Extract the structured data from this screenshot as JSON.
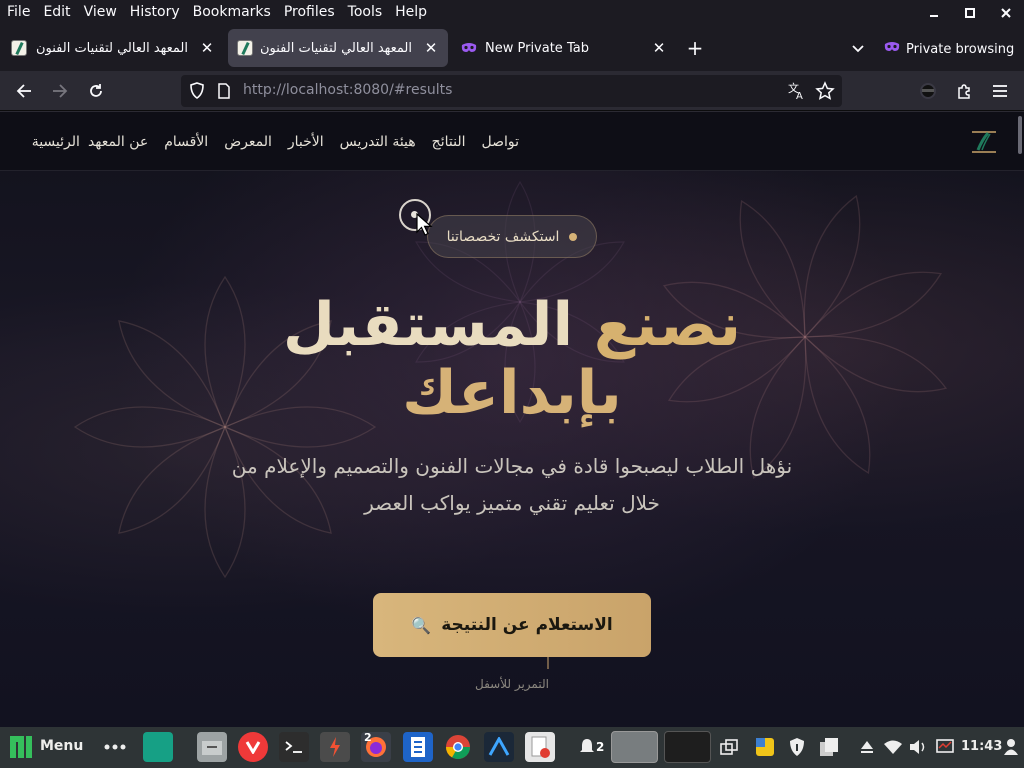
{
  "menubar": {
    "items": [
      "File",
      "Edit",
      "View",
      "History",
      "Bookmarks",
      "Profiles",
      "Tools",
      "Help"
    ],
    "window_controls": [
      "minimize-icon",
      "maximize-icon",
      "close-icon"
    ]
  },
  "tabs": [
    {
      "title": "المعهد العالي لتقنيات الفنون -",
      "close": "✕",
      "selected": false
    },
    {
      "title": "المعهد العالي لتقنيات الفنون",
      "close": "✕",
      "selected": true
    },
    {
      "title": "New Private Tab",
      "close": "✕",
      "selected": false
    }
  ],
  "tabstrip": {
    "new_tab": "+",
    "private_label": "Private browsing"
  },
  "navbar": {
    "url_host": "http://localhost",
    "url_rest": ":8080/#results"
  },
  "site": {
    "nav": [
      "الرئيسية",
      "عن المعهد",
      "الأقسام",
      "المعرض",
      "الأخبار",
      "هيئة التدريس",
      "النتائج",
      "تواصل"
    ],
    "badge": "استكشف تخصصاتنا",
    "title_line1_plain": "المستقبل",
    "title_line1_accent": "نصنع",
    "title_line2": "بإبداعك",
    "subtitle_line1": "نؤهل الطلاب ليصبحوا قادة في مجالات الفنون والتصميم والإعلام من",
    "subtitle_line2": "خلال تعليم تقني متميز يواكب العصر",
    "cta_label": "الاستعلام عن النتيجة",
    "cta_icon": "🔍",
    "scroll_hint": "التمرير للأسفل"
  },
  "taskbar": {
    "menu_label": "Menu",
    "clock": "11:43",
    "firefox_badge": "2",
    "notification_count": "2"
  },
  "colors": {
    "accent_gold": "#d6b277",
    "browser_dark": "#1c1b22",
    "taskbar": "#2e3436"
  }
}
